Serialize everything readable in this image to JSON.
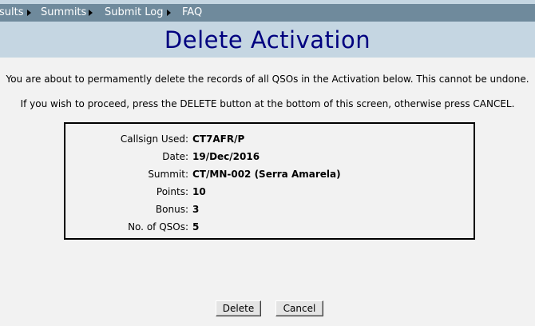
{
  "nav": {
    "items": [
      {
        "label": "sults"
      },
      {
        "label": "Summits"
      },
      {
        "label": "Submit Log"
      },
      {
        "label": "FAQ"
      }
    ]
  },
  "page": {
    "title": "Delete Activation"
  },
  "messages": {
    "warning": "You are about to permamently delete the records of all QSOs in the Activation below. This cannot be undone.",
    "instruction": "If you wish to proceed, press the DELETE button at the bottom of this screen, otherwise press CANCEL."
  },
  "activation": {
    "fields": [
      {
        "label": "Callsign Used:",
        "value": "CT7AFR/P"
      },
      {
        "label": "Date:",
        "value": "19/Dec/2016"
      },
      {
        "label": "Summit:",
        "value": "CT/MN-002 (Serra Amarela)"
      },
      {
        "label": "Points:",
        "value": "10"
      },
      {
        "label": "Bonus:",
        "value": "3"
      },
      {
        "label": "No. of QSOs:",
        "value": "5"
      }
    ]
  },
  "buttons": {
    "delete_label": "Delete",
    "cancel_label": "Cancel"
  }
}
